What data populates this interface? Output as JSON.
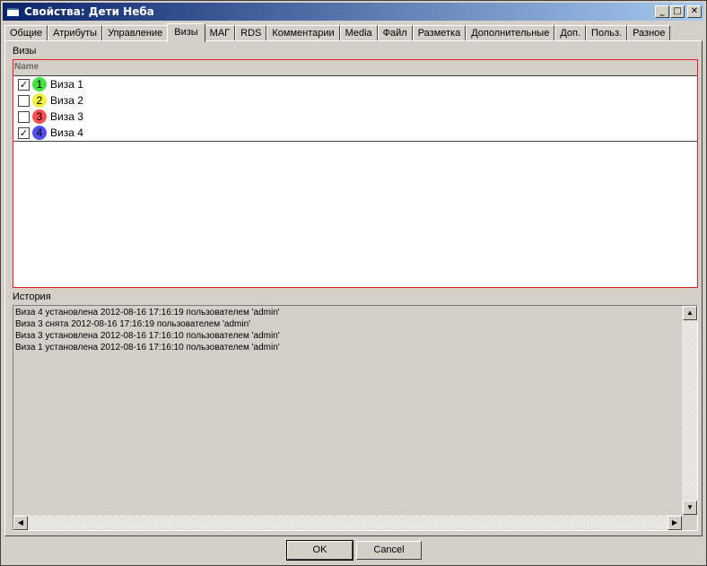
{
  "window": {
    "title": "Свойства: Дети Неба",
    "minimize": "_",
    "maximize": "□",
    "close": "✕"
  },
  "tabs": [
    "Общие",
    "Атрибуты",
    "Управление",
    "Визы",
    "МАГ",
    "RDS",
    "Комментарии",
    "Media",
    "Файл",
    "Разметка",
    "Дополнительные",
    "Доп.",
    "Польз.",
    "Разное"
  ],
  "active_tab": "Визы",
  "visas": {
    "section_label": "Визы",
    "column_header": "Name",
    "items": [
      {
        "number": "1",
        "label": "Виза 1",
        "checked": true,
        "color": "#44e044"
      },
      {
        "number": "2",
        "label": "Виза 2",
        "checked": false,
        "color": "#f0f040"
      },
      {
        "number": "3",
        "label": "Виза 3",
        "checked": false,
        "color": "#ff5050"
      },
      {
        "number": "4",
        "label": "Виза 4",
        "checked": true,
        "color": "#5050f0"
      }
    ]
  },
  "history": {
    "section_label": "История",
    "lines": [
      "Виза 4 установлена 2012-08-16 17:16:19 пользователем 'admin'",
      "Виза 3 снята 2012-08-16 17:16:19 пользователем 'admin'",
      "Виза 3 установлена 2012-08-16 17:16:10 пользователем 'admin'",
      "Виза 1 установлена 2012-08-16 17:16:10 пользователем 'admin'"
    ]
  },
  "buttons": {
    "ok": "OK",
    "cancel": "Cancel"
  }
}
